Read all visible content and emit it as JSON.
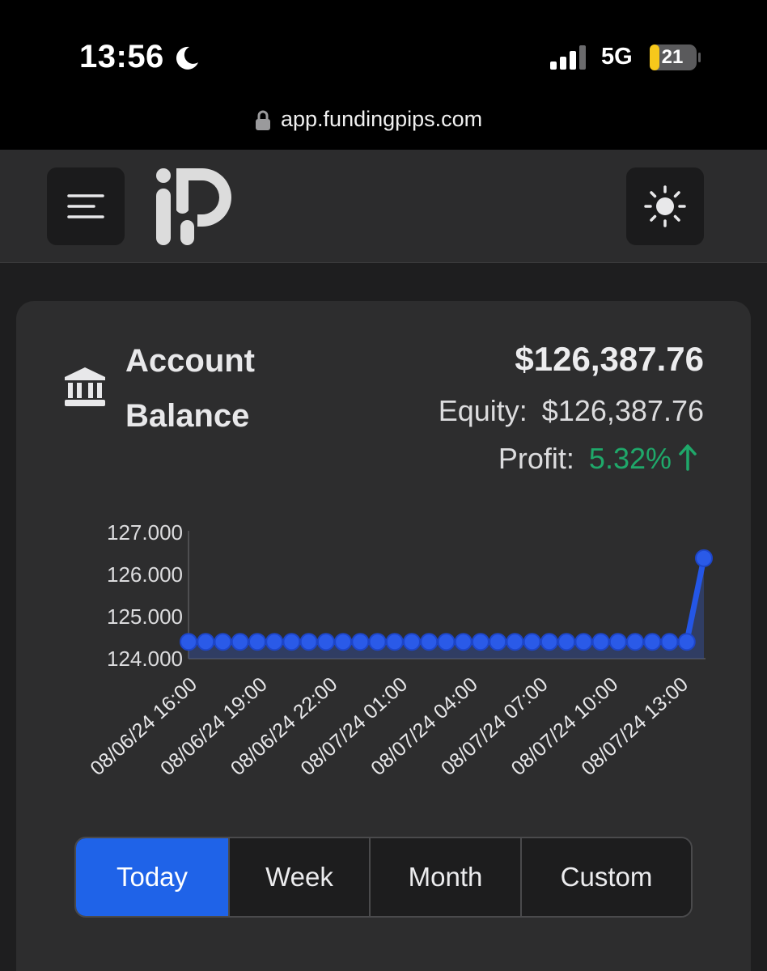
{
  "status_bar": {
    "time": "13:56",
    "network": "5G",
    "battery": "21",
    "url": "app.fundingpips.com"
  },
  "header": {
    "menu_icon": "hamburger-menu-icon",
    "logo_icon": "fundingpips-logo",
    "theme_icon": "sun-icon"
  },
  "account": {
    "title": "Account Balance",
    "title_icon": "bank-icon",
    "balance": "$126,387.76",
    "equity_label": "Equity:",
    "equity_value": "$126,387.76",
    "profit_label": "Profit:",
    "profit_value": "5.32%",
    "profit_color": "#1fa86a"
  },
  "chart_data": {
    "type": "area",
    "y_tick_labels": [
      "127.000",
      "126.000",
      "125.000",
      "124.000"
    ],
    "ylim": [
      124000,
      127000
    ],
    "x_tick_labels": [
      "08/06/24 16:00",
      "08/06/24 19:00",
      "08/06/24 22:00",
      "08/07/24 01:00",
      "08/07/24 04:00",
      "08/07/24 07:00",
      "08/07/24 10:00",
      "08/07/24 13:00"
    ],
    "series": [
      {
        "color": "#2456e6",
        "values": [
          124400,
          124400,
          124400,
          124400,
          124400,
          124400,
          124400,
          124400,
          124400,
          124400,
          124400,
          124400,
          124400,
          124400,
          124400,
          124400,
          124400,
          124400,
          124400,
          124400,
          124400,
          124400,
          124400,
          124400,
          124400,
          124400,
          124400,
          124400,
          124400,
          124400,
          126388
        ]
      }
    ]
  },
  "range_selector": {
    "options": [
      "Today",
      "Week",
      "Month",
      "Custom"
    ],
    "active": "Today",
    "active_color": "#1f63e8"
  }
}
